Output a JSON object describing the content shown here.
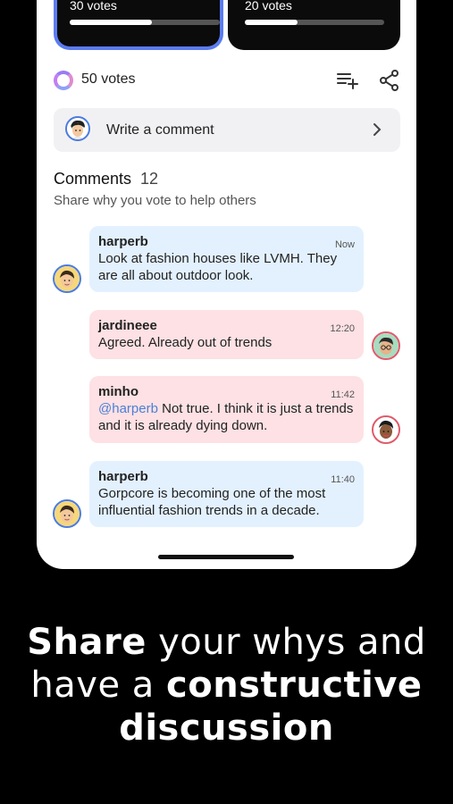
{
  "polls": {
    "option_a": {
      "votes_label": "30 votes",
      "fill": 0.55
    },
    "option_b": {
      "votes_label": "20 votes",
      "fill": 0.38
    }
  },
  "summary": {
    "total_votes": "50 votes"
  },
  "icons": {
    "add_to_list": "playlist-add-icon",
    "share": "share-icon",
    "chevron": "chevron-right-icon"
  },
  "composer": {
    "placeholder": "Write a comment"
  },
  "comments_header": {
    "title": "Comments",
    "count": "12",
    "subtitle": "Share why you vote to help others"
  },
  "comments": [
    {
      "author": "harperb",
      "time": "Now",
      "text": "Look at fashion houses like LVMH. They are all about outdoor look."
    },
    {
      "author": "jardineee",
      "time": "12:20",
      "text": "Agreed. Already out of trends"
    },
    {
      "author": "minho",
      "time": "11:42",
      "mention": "@harperb",
      "text": " Not true. I think it is just a trends and it is already dying down."
    },
    {
      "author": "harperb",
      "time": "11:40",
      "text": "Gorpcore is becoming one of the most influential fashion trends in a decade."
    }
  ],
  "tagline": {
    "bold1": "Share",
    "light1": " your whys and",
    "light2": "have a ",
    "bold2": "constructive",
    "bold3": "discussion"
  },
  "colors": {
    "selected_border": "#5b7cf0",
    "bubble_blue": "#e3f1ff",
    "bubble_pink": "#fde1e4",
    "mention": "#4d7fd6"
  }
}
